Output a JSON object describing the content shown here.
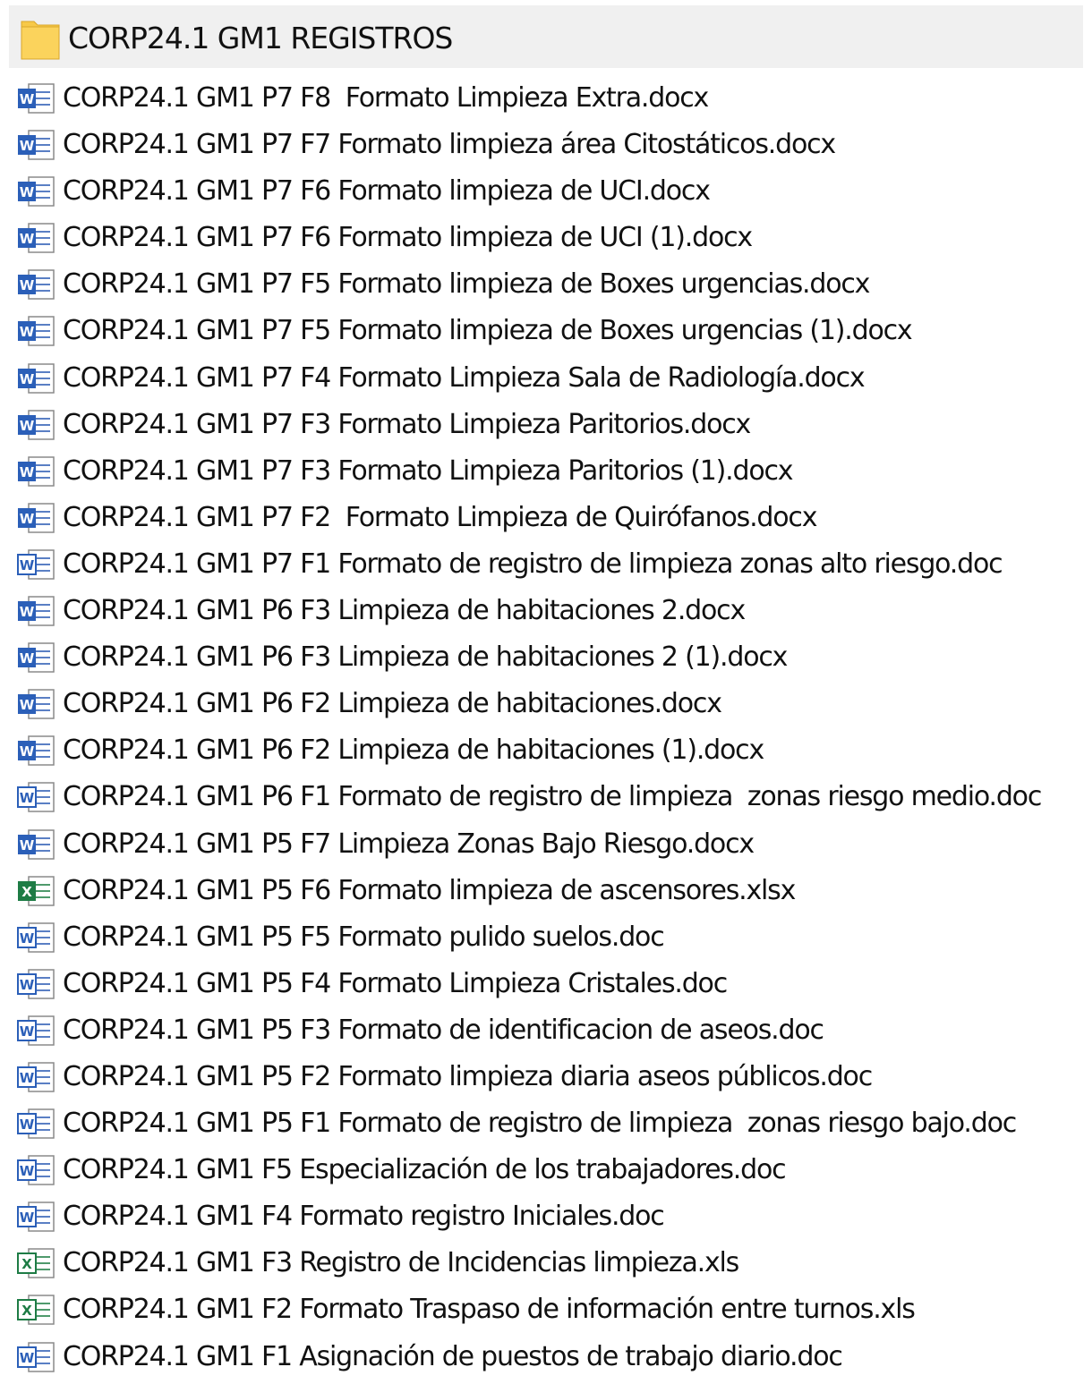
{
  "folder": {
    "name": "CORP24.1 GM1 REGISTROS",
    "icon": "folder-icon",
    "color": "#f5c842"
  },
  "colors": {
    "word_modern": "#2b5fb8",
    "word_legacy": "#2b5fb8",
    "excel": "#1e7c45"
  },
  "files": [
    {
      "name": "CORP24.1 GM1 P7 F8  Formato Limpieza Extra.docx",
      "icon": "word-docx-icon"
    },
    {
      "name": "CORP24.1 GM1 P7 F7 Formato limpieza área Citostáticos.docx",
      "icon": "word-docx-icon"
    },
    {
      "name": "CORP24.1 GM1 P7 F6 Formato limpieza de UCI.docx",
      "icon": "word-docx-icon"
    },
    {
      "name": "CORP24.1 GM1 P7 F6 Formato limpieza de UCI (1).docx",
      "icon": "word-docx-icon"
    },
    {
      "name": "CORP24.1 GM1 P7 F5 Formato limpieza de Boxes urgencias.docx",
      "icon": "word-docx-icon"
    },
    {
      "name": "CORP24.1 GM1 P7 F5 Formato limpieza de Boxes urgencias (1).docx",
      "icon": "word-docx-icon"
    },
    {
      "name": "CORP24.1 GM1 P7 F4 Formato Limpieza Sala de Radiología.docx",
      "icon": "word-docx-icon"
    },
    {
      "name": "CORP24.1 GM1 P7 F3 Formato Limpieza Paritorios.docx",
      "icon": "word-docx-icon"
    },
    {
      "name": "CORP24.1 GM1 P7 F3 Formato Limpieza Paritorios (1).docx",
      "icon": "word-docx-icon"
    },
    {
      "name": "CORP24.1 GM1 P7 F2  Formato Limpieza de Quirófanos.docx",
      "icon": "word-docx-icon"
    },
    {
      "name": "CORP24.1 GM1 P7 F1 Formato de registro de limpieza zonas alto riesgo.doc",
      "icon": "word-doc-icon"
    },
    {
      "name": "CORP24.1 GM1 P6 F3 Limpieza de habitaciones 2.docx",
      "icon": "word-docx-icon"
    },
    {
      "name": "CORP24.1 GM1 P6 F3 Limpieza de habitaciones 2 (1).docx",
      "icon": "word-docx-icon"
    },
    {
      "name": "CORP24.1 GM1 P6 F2 Limpieza de habitaciones.docx",
      "icon": "word-docx-icon"
    },
    {
      "name": "CORP24.1 GM1 P6 F2 Limpieza de habitaciones (1).docx",
      "icon": "word-docx-icon"
    },
    {
      "name": "CORP24.1 GM1 P6 F1 Formato de registro de limpieza  zonas riesgo medio.doc",
      "icon": "word-doc-icon"
    },
    {
      "name": "CORP24.1 GM1 P5 F7 Limpieza Zonas Bajo Riesgo.docx",
      "icon": "word-docx-icon"
    },
    {
      "name": "CORP24.1 GM1 P5 F6 Formato limpieza de ascensores.xlsx",
      "icon": "excel-xlsx-icon"
    },
    {
      "name": "CORP24.1 GM1 P5 F5 Formato pulido suelos.doc",
      "icon": "word-doc-icon"
    },
    {
      "name": "CORP24.1 GM1 P5 F4 Formato Limpieza Cristales.doc",
      "icon": "word-doc-icon"
    },
    {
      "name": "CORP24.1 GM1 P5 F3 Formato de identificacion de aseos.doc",
      "icon": "word-doc-icon"
    },
    {
      "name": "CORP24.1 GM1 P5 F2 Formato limpieza diaria aseos públicos.doc",
      "icon": "word-doc-icon"
    },
    {
      "name": "CORP24.1 GM1 P5 F1 Formato de registro de limpieza  zonas riesgo bajo.doc",
      "icon": "word-doc-icon"
    },
    {
      "name": "CORP24.1 GM1 F5 Especialización de los trabajadores.doc",
      "icon": "word-doc-icon"
    },
    {
      "name": "CORP24.1 GM1 F4 Formato registro Iniciales.doc",
      "icon": "word-doc-icon"
    },
    {
      "name": "CORP24.1 GM1 F3 Registro de Incidencias limpieza.xls",
      "icon": "excel-xls-icon"
    },
    {
      "name": "CORP24.1 GM1 F2 Formato Traspaso de información entre turnos.xls",
      "icon": "excel-xls-icon"
    },
    {
      "name": "CORP24.1 GM1 F1 Asignación de puestos de trabajo diario.doc",
      "icon": "word-doc-icon"
    }
  ]
}
